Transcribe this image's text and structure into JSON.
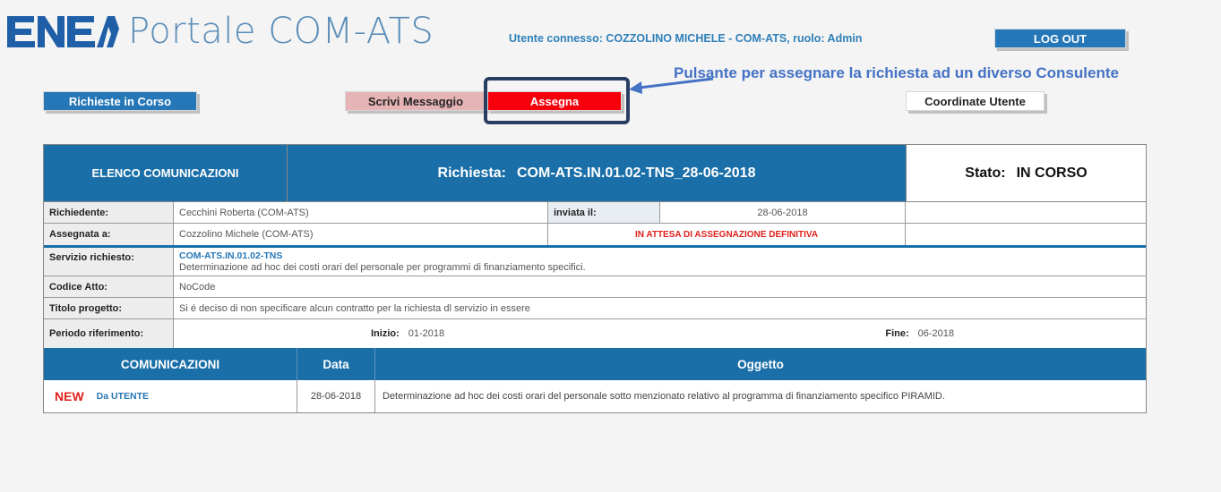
{
  "header": {
    "logo_text": "ENEA",
    "app_title": "Portale COM-ATS",
    "user_info": "Utente connesso: COZZOLINO MICHELE - COM-ATS, ruolo: Admin",
    "logout_label": "LOG OUT"
  },
  "toolbar": {
    "richieste_label": "Richieste in Corso",
    "scrivi_label": "Scrivi Messaggio",
    "assegna_label": "Assegna",
    "coordinate_label": "Coordinate Utente"
  },
  "annotation": {
    "text": "Pulsante per assegnare la richiesta ad un diverso  Consulente"
  },
  "panel": {
    "elenco_label": "ELENCO COMUNICAZIONI",
    "richiesta_label": "Richiesta:",
    "richiesta_code": "COM-ATS.IN.01.02-TNS_28-06-2018",
    "stato_label": "Stato:",
    "stato_value": "IN CORSO",
    "richiedente_label": "Richiedente:",
    "richiedente_value": "Cecchini Roberta (COM-ATS)",
    "inviata_label": "inviata il:",
    "inviata_value": "28-06-2018",
    "assegnata_label": "Assegnata a:",
    "assegnata_value": "Cozzolino Michele (COM-ATS)",
    "attesa_text": "IN ATTESA DI ASSEGNAZIONE DEFINITIVA",
    "servizio_label": "Servizio richiesto:",
    "servizio_code": "COM-ATS.IN.01.02-TNS",
    "servizio_desc": "Determinazione ad hoc dei costi orari del personale per programmi di finanziamento specifici.",
    "codice_label": "Codice Atto:",
    "codice_value": "NoCode",
    "titolo_label": "Titolo progetto:",
    "titolo_value": "Si é deciso di non specificare alcun contratto per la richiesta dl servizio in essere",
    "periodo_label": "Periodo riferimento:",
    "inizio_label": "Inizio:",
    "inizio_value": "01-2018",
    "fine_label": "Fine:",
    "fine_value": "06-2018"
  },
  "comunicazioni": {
    "headers": [
      "COMUNICAZIONI",
      "Data",
      "Oggetto"
    ],
    "rows": [
      {
        "badge": "NEW",
        "from": "Da UTENTE",
        "date": "28-06-2018",
        "subject": "Determinazione ad hoc dei costi orari del personale sotto menzionato relativo al programma di finanziamento specifico PIRAMID."
      }
    ]
  },
  "colors": {
    "brand_blue": "#1a6fa8",
    "button_blue": "#2577b7",
    "assegna_red": "#f5000b",
    "scrivi_pink": "#e6b4b6",
    "annotation_blue": "#4472c4",
    "highlight_navy": "#283e63"
  }
}
